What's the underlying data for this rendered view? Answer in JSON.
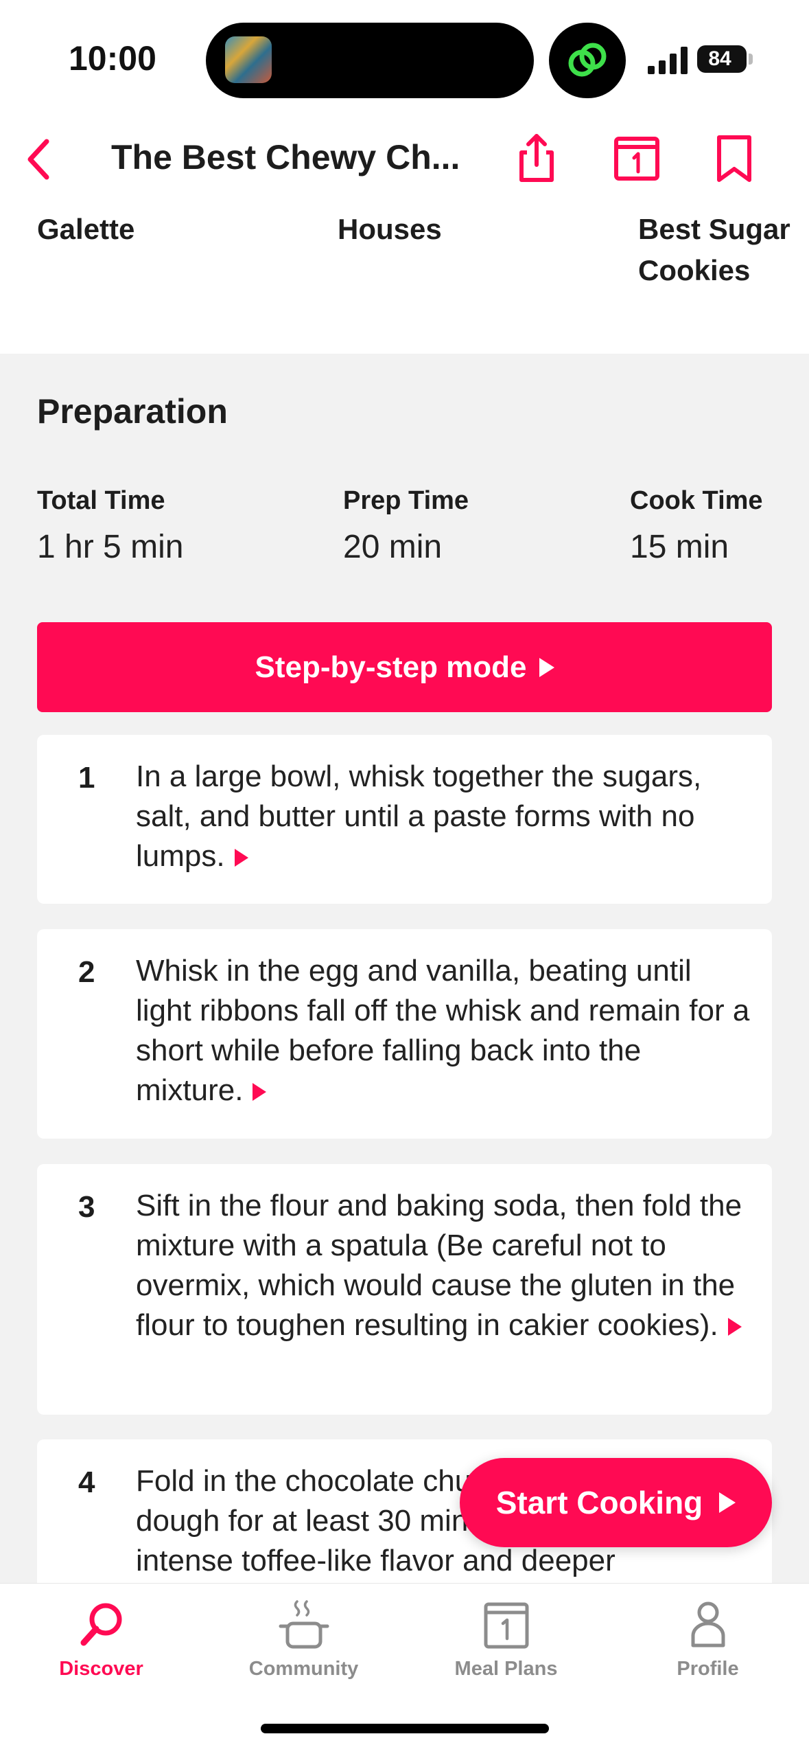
{
  "status_bar": {
    "time": "10:00",
    "battery": "84"
  },
  "nav": {
    "title": "The Best Chewy Ch..."
  },
  "related": [
    {
      "label": "Galette"
    },
    {
      "label": "Houses"
    },
    {
      "label": "Best Sugar Cookies"
    }
  ],
  "preparation": {
    "title": "Preparation",
    "times": [
      {
        "label": "Total Time",
        "value": "1 hr 5 min"
      },
      {
        "label": "Prep Time",
        "value": "20 min"
      },
      {
        "label": "Cook Time",
        "value": "15 min"
      }
    ],
    "step_mode_label": "Step-by-step mode"
  },
  "steps": [
    {
      "num": "1",
      "text": "In a large bowl, whisk together the sugars, salt, and butter until a paste forms with no lumps."
    },
    {
      "num": "2",
      "text": "Whisk in the egg and vanilla, beating until light ribbons fall off the whisk and remain for a short while before falling back into the mixture."
    },
    {
      "num": "3",
      "text": "Sift in the flour and baking soda, then fold the mixture with a spatula (Be careful not to overmix, which would cause the gluten in the flour to toughen resulting in cakier cookies)."
    },
    {
      "num": "4",
      "text": "Fold in the chocolate chunks, then chill the dough for at least 30 minutes. For a more intense toffee-like flavor and deeper"
    }
  ],
  "start_cooking_label": "Start Cooking",
  "tabs": [
    {
      "label": "Discover"
    },
    {
      "label": "Community"
    },
    {
      "label": "Meal Plans"
    },
    {
      "label": "Profile"
    }
  ],
  "colors": {
    "accent": "#ff0a53",
    "background": "#f2f2f2",
    "inactive_tab": "#8c8c8c"
  }
}
